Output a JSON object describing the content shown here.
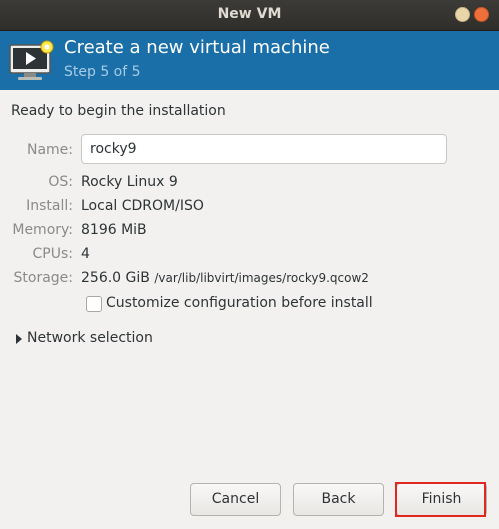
{
  "window": {
    "title": "New VM"
  },
  "header": {
    "title": "Create a new virtual machine",
    "step": "Step 5 of 5",
    "icon": "vm-monitor-icon"
  },
  "summary": {
    "ready_text": "Ready to begin the installation",
    "name_label": "Name:",
    "name_value": "rocky9",
    "os_label": "OS:",
    "os_value": "Rocky Linux 9",
    "install_label": "Install:",
    "install_value": "Local CDROM/ISO",
    "memory_label": "Memory:",
    "memory_value": "8196 MiB",
    "cpus_label": "CPUs:",
    "cpus_value": "4",
    "storage_label": "Storage:",
    "storage_size": "256.0 GiB",
    "storage_path": "/var/lib/libvirt/images/rocky9.qcow2",
    "customize_label": "Customize configuration before install",
    "customize_checked": false
  },
  "network": {
    "label": "Network selection",
    "expanded": false
  },
  "buttons": {
    "cancel": "Cancel",
    "back": "Back",
    "finish": "Finish"
  },
  "colors": {
    "header_bg": "#1a6fa8",
    "highlight": "#e0281f"
  }
}
